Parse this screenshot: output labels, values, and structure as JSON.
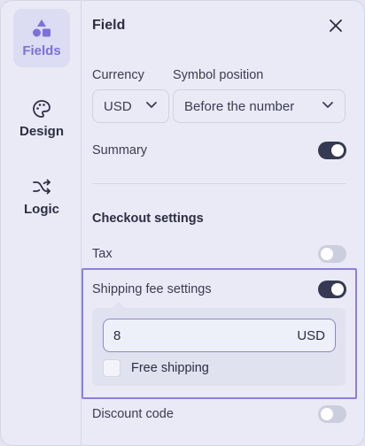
{
  "rail": {
    "items": [
      {
        "label": "Fields",
        "icon": "shapes-icon",
        "active": true
      },
      {
        "label": "Design",
        "icon": "palette-icon",
        "active": false
      },
      {
        "label": "Logic",
        "icon": "shuffle-icon",
        "active": false
      }
    ]
  },
  "panel": {
    "title": "Field",
    "currency": {
      "label": "Currency",
      "value": "USD"
    },
    "symbol_position": {
      "label": "Symbol position",
      "value": "Before the number"
    },
    "summary": {
      "label": "Summary",
      "on": true
    },
    "checkout": {
      "title": "Checkout settings",
      "tax": {
        "label": "Tax",
        "on": false
      },
      "shipping": {
        "label": "Shipping fee settings",
        "on": true,
        "amount": "8",
        "unit": "USD",
        "free_shipping_label": "Free shipping",
        "free_shipping_checked": false
      },
      "discount": {
        "label": "Discount code",
        "on": false
      }
    }
  },
  "colors": {
    "accent": "#7c71d8",
    "highlight_border": "#8b7fe0",
    "toggle_on": "#353a52",
    "toggle_off": "#cbcedd"
  }
}
